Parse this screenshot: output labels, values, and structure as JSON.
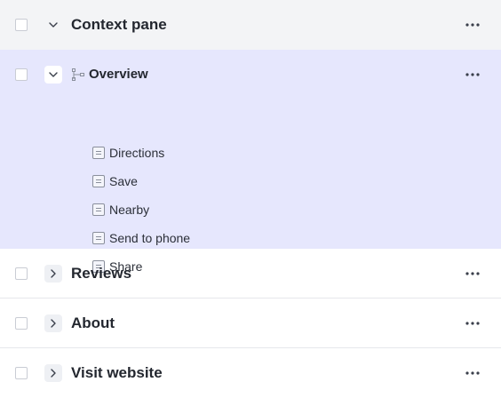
{
  "tree": {
    "sections": [
      {
        "label": "Context pane",
        "expanded": true,
        "style": "header"
      },
      {
        "label": "Reviews",
        "expanded": false
      },
      {
        "label": "About",
        "expanded": false
      },
      {
        "label": "Visit website",
        "expanded": false
      }
    ],
    "overview": {
      "label": "Overview",
      "children": [
        {
          "label": "Directions"
        },
        {
          "label": "Save"
        },
        {
          "label": "Nearby"
        },
        {
          "label": "Send to phone"
        },
        {
          "label": "Share"
        }
      ]
    },
    "icons": {
      "checkbox": "checkbox-icon",
      "expand": "chevron-down-icon",
      "collapse": "chevron-right-icon",
      "more": "more-horizontal-icon",
      "node": "tree-structure-icon",
      "doc": "document-icon"
    },
    "colors": {
      "selected_bg": "#e6e7fd",
      "header_bg": "#f3f4f6"
    }
  }
}
